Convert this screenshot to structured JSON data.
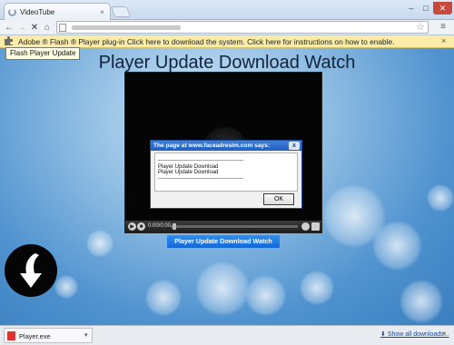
{
  "browser": {
    "tab_title": "VideoTube",
    "tab_close": "×",
    "window_controls": {
      "minimize": "–",
      "maximize": "□",
      "close": "✕"
    },
    "nav": {
      "back": "←",
      "forward": "→",
      "stop": "✕",
      "home": "⌂",
      "star": "☆",
      "menu": "≡"
    }
  },
  "infobar": {
    "text": "Adobe ® Flash ® Player plug-in Click here to download the system. Click here for instructions on how to enable.",
    "close": "×",
    "tooltip": "Flash Player Update",
    "icon": "puzzle-icon"
  },
  "page": {
    "title": "Player Update Download Watch",
    "player": {
      "time": "0:00/0:00"
    },
    "dialog": {
      "title": "The page at www.faceadresim.com says:",
      "close": "x",
      "lines": [
        "-----------------------------------------------",
        "Player Update Download",
        "Player Update Download",
        "-----------------------------------------------"
      ],
      "ok_label": "OK"
    },
    "cta_label": "Player Update Download Watch",
    "download_badge_icon": "down-arrow-icon"
  },
  "download_shelf": {
    "file_name": "Player.exe",
    "chevron": "▾",
    "show_all": "Show all downloads...",
    "close": "×"
  },
  "colors": {
    "infobar_bg": "#fbeda7",
    "cta_bg": "#1f7ae6",
    "dialog_title_bg": "#2a6acb"
  }
}
